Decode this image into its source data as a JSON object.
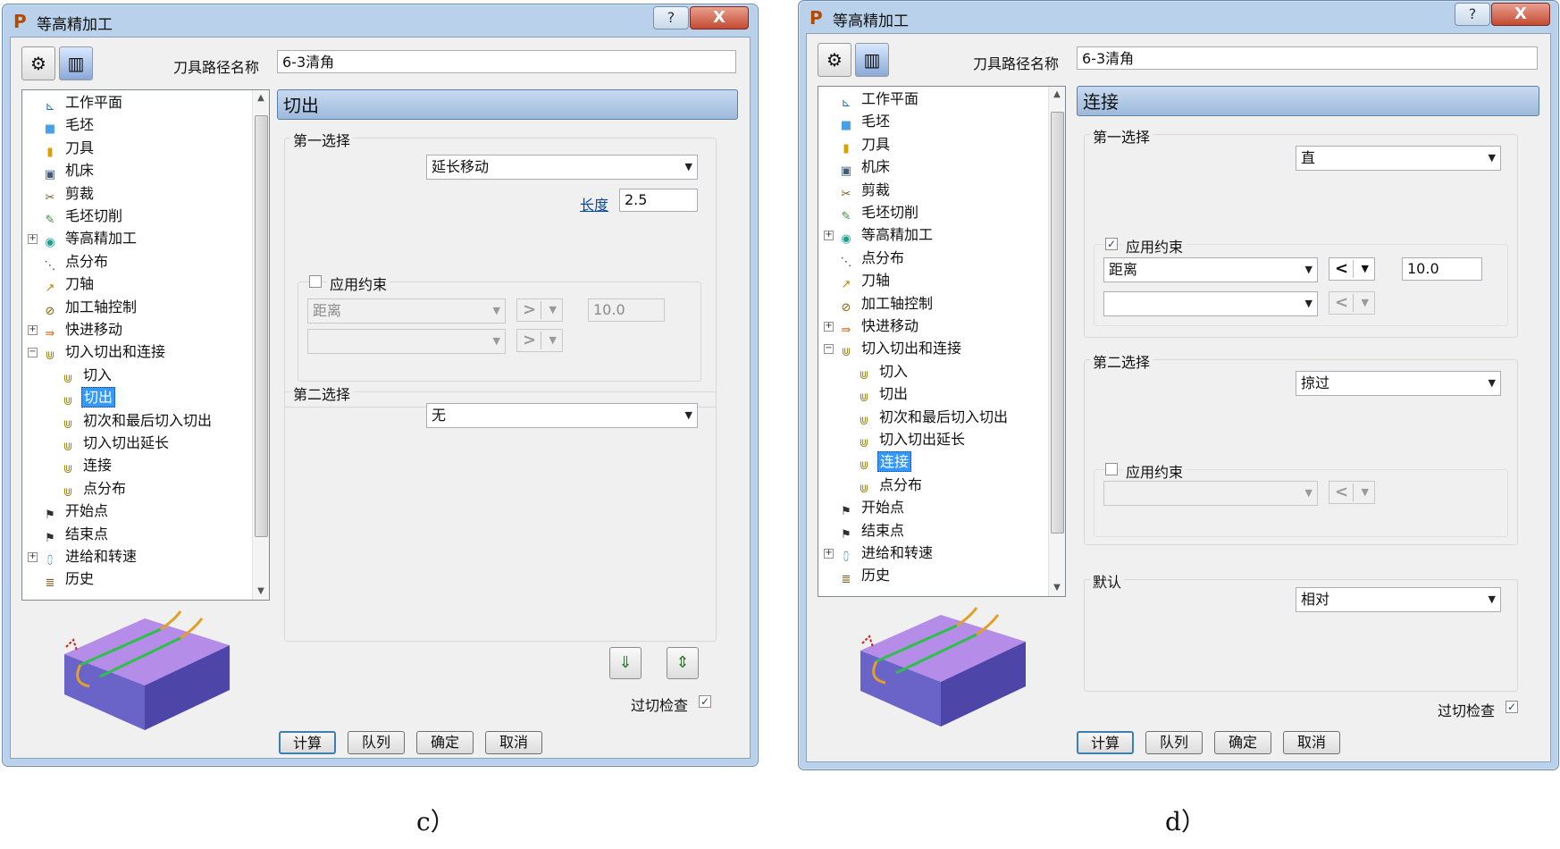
{
  "dialog_c": {
    "title": "等高精加工",
    "help_label": "?",
    "close_label": "X",
    "path_name_label": "刀具路径名称",
    "path_name_value": "6-3清角",
    "tree": [
      "工作平面",
      "毛坯",
      "刀具",
      "机床",
      "剪裁",
      "毛坯切削",
      "等高精加工",
      "点分布",
      "刀轴",
      "加工轴控制",
      "快进移动",
      "切入切出和连接",
      "切入",
      "切出",
      "初次和最后切入切出",
      "切入切出延长",
      "连接",
      "点分布",
      "开始点",
      "结束点",
      "进给和转速",
      "历史"
    ],
    "selected_item": "切出",
    "section_title": "切出",
    "first_choice": {
      "label": "第一选择",
      "type_value": "延长移动",
      "length_label": "长度",
      "length_value": "2.5",
      "apply_constraint_label": "应用约束",
      "apply_constraint_checked": false,
      "constraint1_type": "距离",
      "constraint1_op": ">",
      "constraint1_value": "10.0",
      "constraint2_op": ">"
    },
    "second_choice": {
      "label": "第二选择",
      "type_value": "无"
    },
    "gouge_check_label": "过切检查",
    "gouge_check_checked": true,
    "buttons": {
      "calc": "计算",
      "queue": "队列",
      "ok": "确定",
      "cancel": "取消"
    },
    "caption": "c）"
  },
  "dialog_d": {
    "title": "等高精加工",
    "help_label": "?",
    "close_label": "X",
    "path_name_label": "刀具路径名称",
    "path_name_value": "6-3清角",
    "tree": [
      "工作平面",
      "毛坯",
      "刀具",
      "机床",
      "剪裁",
      "毛坯切削",
      "等高精加工",
      "点分布",
      "刀轴",
      "加工轴控制",
      "快进移动",
      "切入切出和连接",
      "切入",
      "切出",
      "初次和最后切入切出",
      "切入切出延长",
      "连接",
      "点分布",
      "开始点",
      "结束点",
      "进给和转速",
      "历史"
    ],
    "selected_item": "连接",
    "section_title": "连接",
    "first_choice": {
      "label": "第一选择",
      "type_value": "直",
      "apply_constraint_label": "应用约束",
      "apply_constraint_checked": true,
      "constraint1_type": "距离",
      "constraint1_op": "<",
      "constraint1_value": "10.0",
      "constraint2_op": "<"
    },
    "second_choice": {
      "label": "第二选择",
      "type_value": "掠过",
      "apply_constraint_label": "应用约束",
      "apply_constraint_checked": false,
      "constraint_op": "<"
    },
    "default_choice": {
      "label": "默认",
      "type_value": "相对"
    },
    "gouge_check_label": "过切检查",
    "gouge_check_checked": true,
    "buttons": {
      "calc": "计算",
      "queue": "队列",
      "ok": "确定",
      "cancel": "取消"
    },
    "caption": "d）"
  },
  "colors": {
    "title_bg": "#b9d1ea",
    "selection": "#3399ff",
    "section_header": "#9dbadb",
    "preview_top": "#b58ce8",
    "preview_side": "#6b64c8"
  }
}
